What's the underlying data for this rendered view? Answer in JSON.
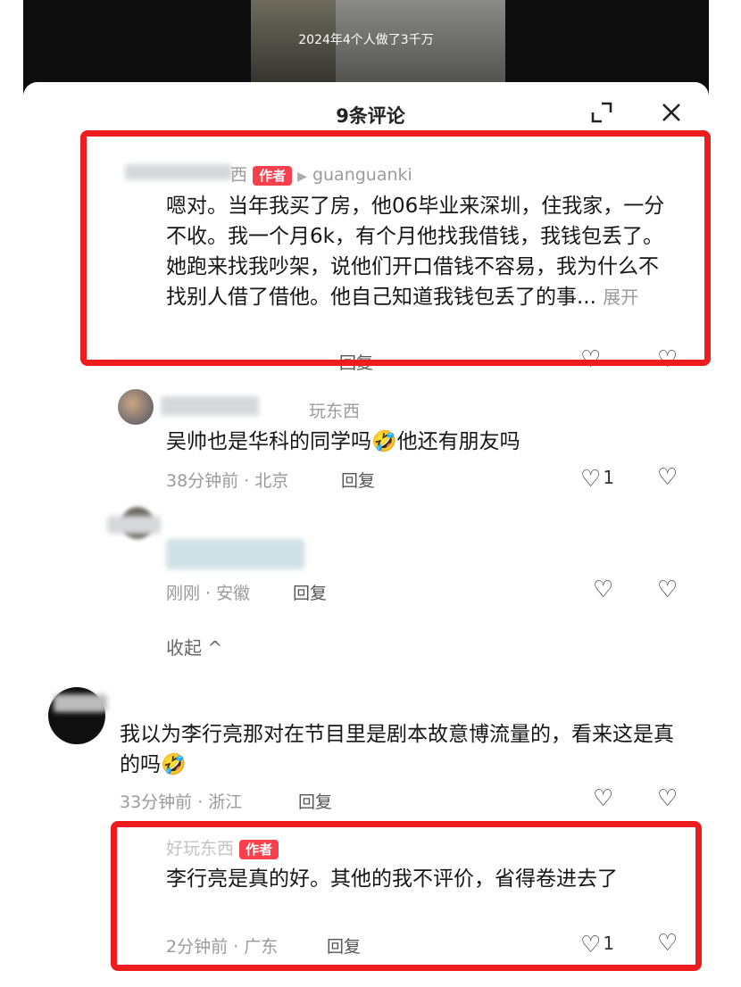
{
  "video": {
    "caption": "2024年4个人做了3千万"
  },
  "header": {
    "title": "9条评论"
  },
  "icons": {
    "expand": "expand-icon",
    "close": "close-icon"
  },
  "comments": [
    {
      "author": "西",
      "badge": "作者",
      "reply_to": "guanguanki",
      "text": "嗯对。当年我买了房，他06毕业来深圳，住我家，一分不收。我一个月6k，有个月他找我借钱，我钱包丢了。她跑来找我吵架，说他们开口借钱不容易，我为什么不找别人借了借他。他自己知道我钱包丢了的事...",
      "expand": "展开",
      "reply": "回复"
    },
    {
      "author": "玩东西",
      "text": "吴帅也是华科的同学吗🤣他还有朋友吗",
      "meta": "38分钟前 · 北京",
      "reply": "回复",
      "likes": "1"
    },
    {
      "meta": "刚刚 · 安徽",
      "reply": "回复"
    },
    {
      "text": "我以为李行亮那对在节目里是剧本故意博流量的，看来这是真的吗🤣",
      "meta": "33分钟前 · 浙江",
      "reply": "回复"
    },
    {
      "author": "好玩东西",
      "badge": "作者",
      "text": "李行亮是真的好。其他的我不评价，省得卷进去了",
      "meta": "2分钟前 · 广东",
      "reply": "回复",
      "likes": "1"
    }
  ],
  "collapse": "收起 ^",
  "colors": {
    "highlight": "#ee1c1c",
    "badge": "#f7404d"
  }
}
